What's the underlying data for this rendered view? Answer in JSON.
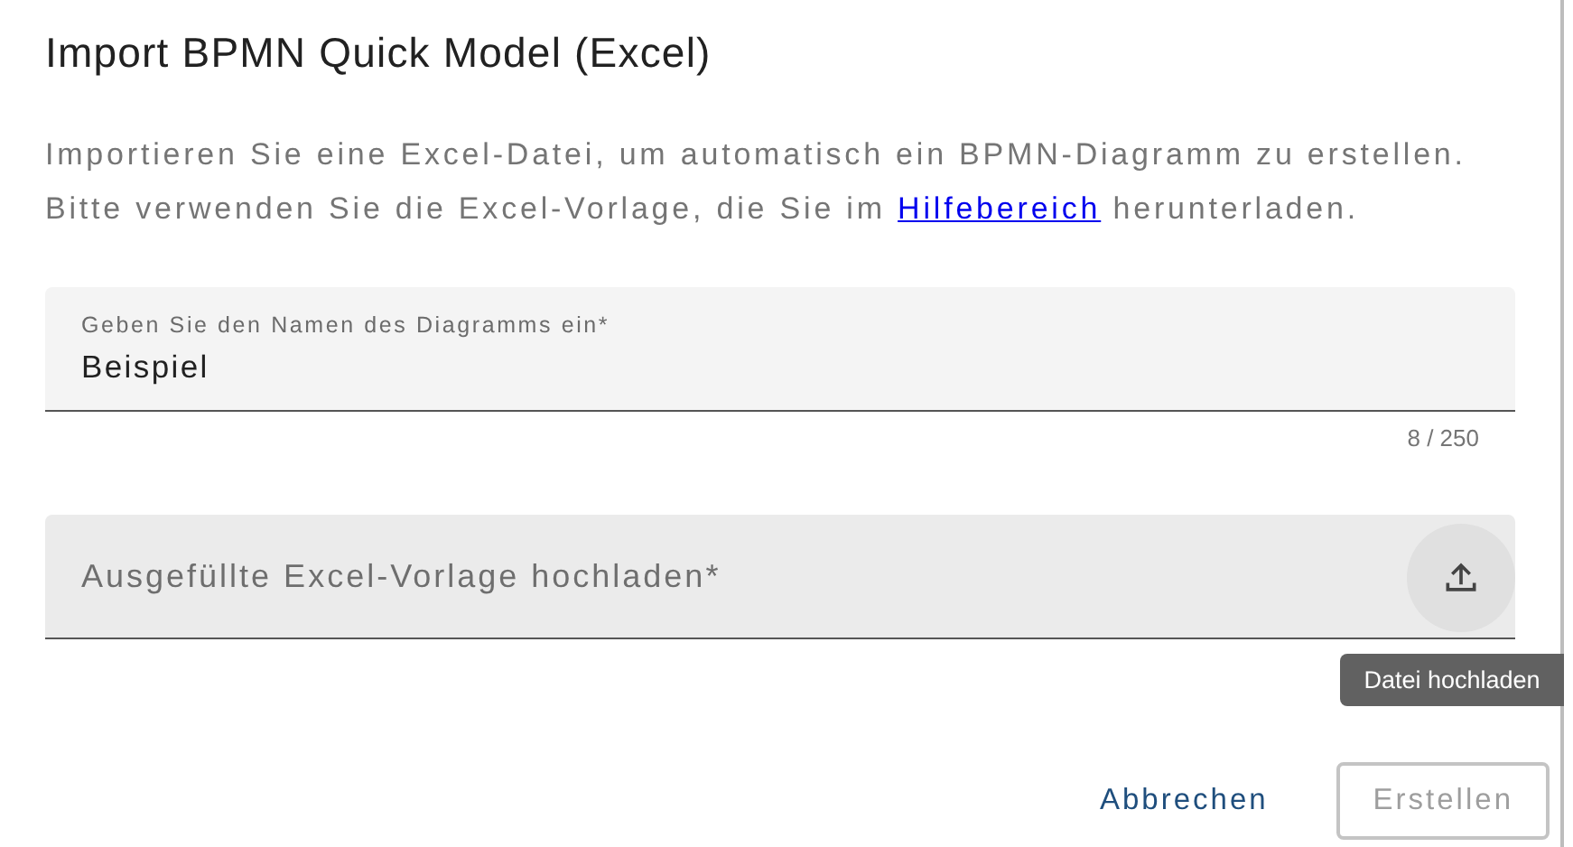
{
  "dialog": {
    "title": "Import BPMN Quick Model (Excel)",
    "description": [
      {
        "kind": "text",
        "text": "Importieren Sie eine Excel-Datei, um automatisch ein BPMN-Diagramm zu erstellen."
      },
      {
        "kind": "linked",
        "before": "Bitte verwenden Sie die Excel-Vorlage, die Sie im",
        "link": "Hilfebereich",
        "after": "herunterladen."
      }
    ],
    "name_field": {
      "label": "Geben Sie den Namen des Diagramms ein*",
      "value": "Beispiel",
      "counter": "8 / 250"
    },
    "upload_field": {
      "placeholder": "Ausgefüllte Excel-Vorlage hochladen*",
      "tooltip": "Datei hochladen"
    },
    "buttons": [
      {
        "label": "Abbrechen",
        "kind": "text",
        "disabled": false
      },
      {
        "label": "Erstellen",
        "kind": "outlined",
        "disabled": true
      }
    ]
  }
}
